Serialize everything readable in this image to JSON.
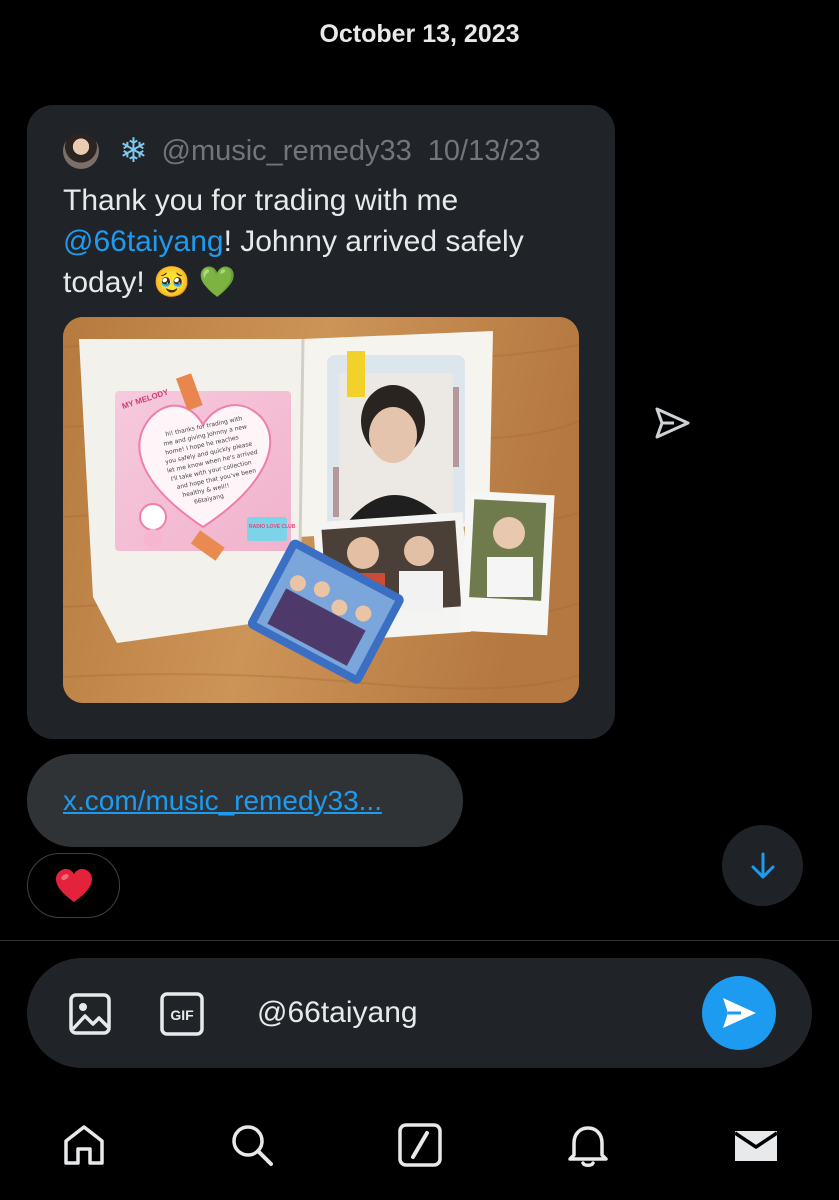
{
  "conversation": {
    "date_header": "October 13, 2023"
  },
  "quoted_post": {
    "handle": "@music_remedy33",
    "date": "10/13/23",
    "text_before": "Thank you for trading with me ",
    "mention": "@66taiyang",
    "text_after": "! Johnny arrived safely today! 🥹 💚"
  },
  "photo_elements": {
    "card_title": "MY MELODY",
    "note_lines": [
      "hi! thanks for trading with",
      "me and giving Johnny a new",
      "home! I hope he reaches",
      "you safely and quickly please",
      "let me know when he's arrived",
      "I'll take with your collection",
      "and hope that you've been",
      "healthy & well!!",
      "66taiyang"
    ],
    "sticker_text": "RADIO LOVE CLUB"
  },
  "link": {
    "text": "x.com/music_remedy33..."
  },
  "reaction": {
    "emoji": "❤️"
  },
  "composer": {
    "value": "@66taiyang"
  },
  "icons": {
    "share": "send-outline-icon",
    "scroll": "arrow-down-icon",
    "image": "image-icon",
    "gif": "gif-icon",
    "send": "send-icon",
    "nav": [
      "home-icon",
      "search-icon",
      "grok-icon",
      "bell-icon",
      "mail-icon"
    ]
  },
  "colors": {
    "accent": "#1d9bf0",
    "background": "#000000",
    "bubble": "#202327",
    "muted_text": "#71767b"
  }
}
